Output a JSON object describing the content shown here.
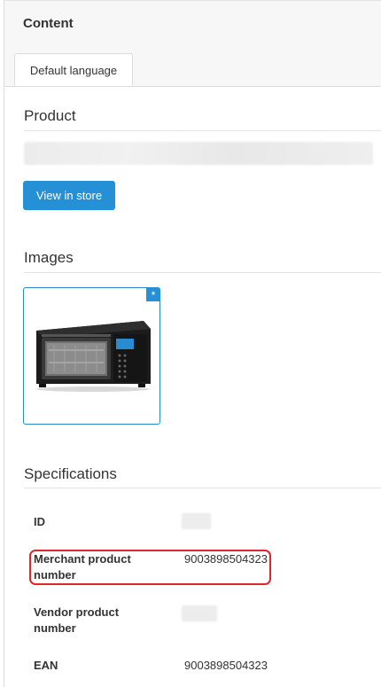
{
  "panel": {
    "title": "Content"
  },
  "tabs": [
    {
      "label": "Default language"
    }
  ],
  "product": {
    "section_title": "Product",
    "view_button_label": "View in store"
  },
  "images": {
    "section_title": "Images",
    "primary_badge": "*"
  },
  "specifications": {
    "section_title": "Specifications",
    "rows": [
      {
        "label": "ID",
        "value": ""
      },
      {
        "label": "Merchant product number",
        "value": "9003898504323"
      },
      {
        "label": "Vendor product number",
        "value": ""
      },
      {
        "label": "EAN",
        "value": "9003898504323"
      }
    ]
  },
  "colors": {
    "accent": "#2590d5",
    "highlight": "#e0262c"
  }
}
